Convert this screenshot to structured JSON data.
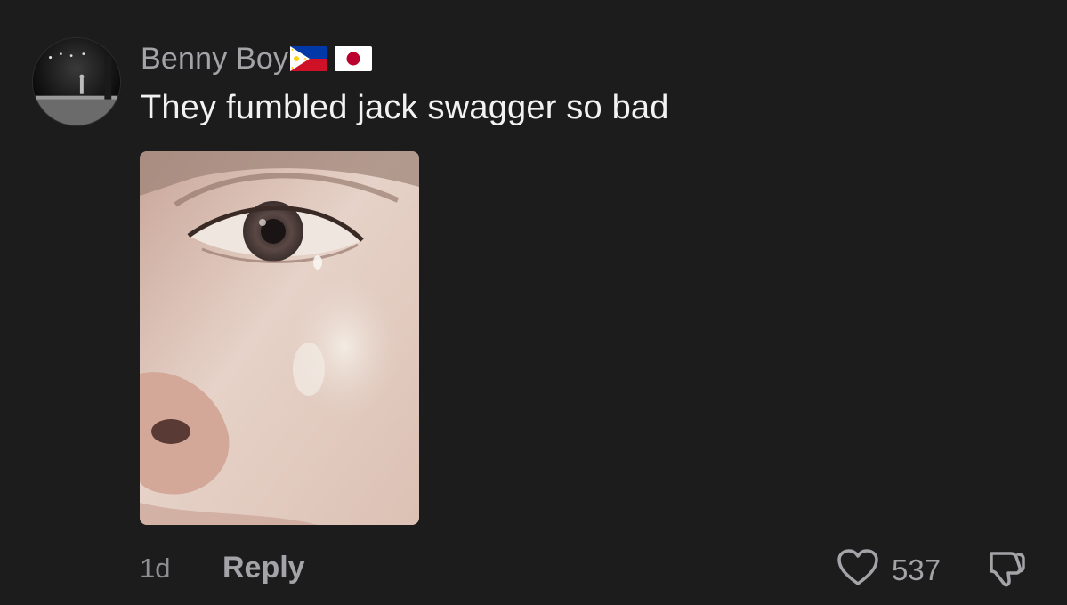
{
  "comment": {
    "username": "Benny Boy",
    "flags": [
      "philippines-flag-icon",
      "japan-flag-icon"
    ],
    "text": "They fumbled jack swagger so bad",
    "attachment": "crying-eye-reaction-image"
  },
  "footer": {
    "timestamp": "1d",
    "reply_label": "Reply",
    "like_count": "537"
  },
  "colors": {
    "background": "#1c1c1d",
    "username": "#a3a3a8",
    "comment_text": "#f2f2f2",
    "meta": "#8e8e93"
  },
  "icons": {
    "like": "heart-outline-icon",
    "dislike": "thumbs-down-outline-icon"
  }
}
